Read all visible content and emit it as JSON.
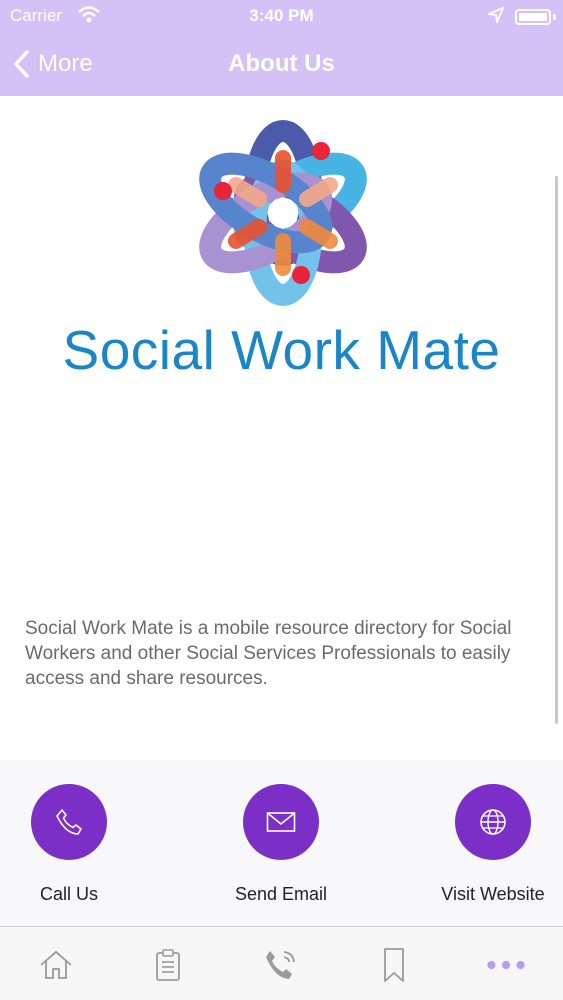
{
  "status_bar": {
    "carrier": "Carrier",
    "time": "3:40 PM"
  },
  "nav": {
    "back_label": "More",
    "title": "About Us"
  },
  "logo": {
    "text": "Social Work Mate"
  },
  "about": {
    "description": "Social Work Mate is a mobile resource directory for Social Workers and other Social Services Professionals to easily access and share resources."
  },
  "actions": [
    {
      "label": "Call Us",
      "icon": "phone-icon"
    },
    {
      "label": "Send Email",
      "icon": "envelope-icon"
    },
    {
      "label": "Visit Website",
      "icon": "globe-icon"
    }
  ],
  "tabs": [
    {
      "icon": "home-icon"
    },
    {
      "icon": "clipboard-icon"
    },
    {
      "icon": "phone-call-icon"
    },
    {
      "icon": "bookmark-icon"
    },
    {
      "icon": "more-icon",
      "active": true
    }
  ],
  "colors": {
    "header": "#d4c2f7",
    "accent": "#7b2fc7",
    "logo_text": "#1a86c7",
    "tab_inactive": "#9a9a9a",
    "tab_active": "#b79df0"
  }
}
